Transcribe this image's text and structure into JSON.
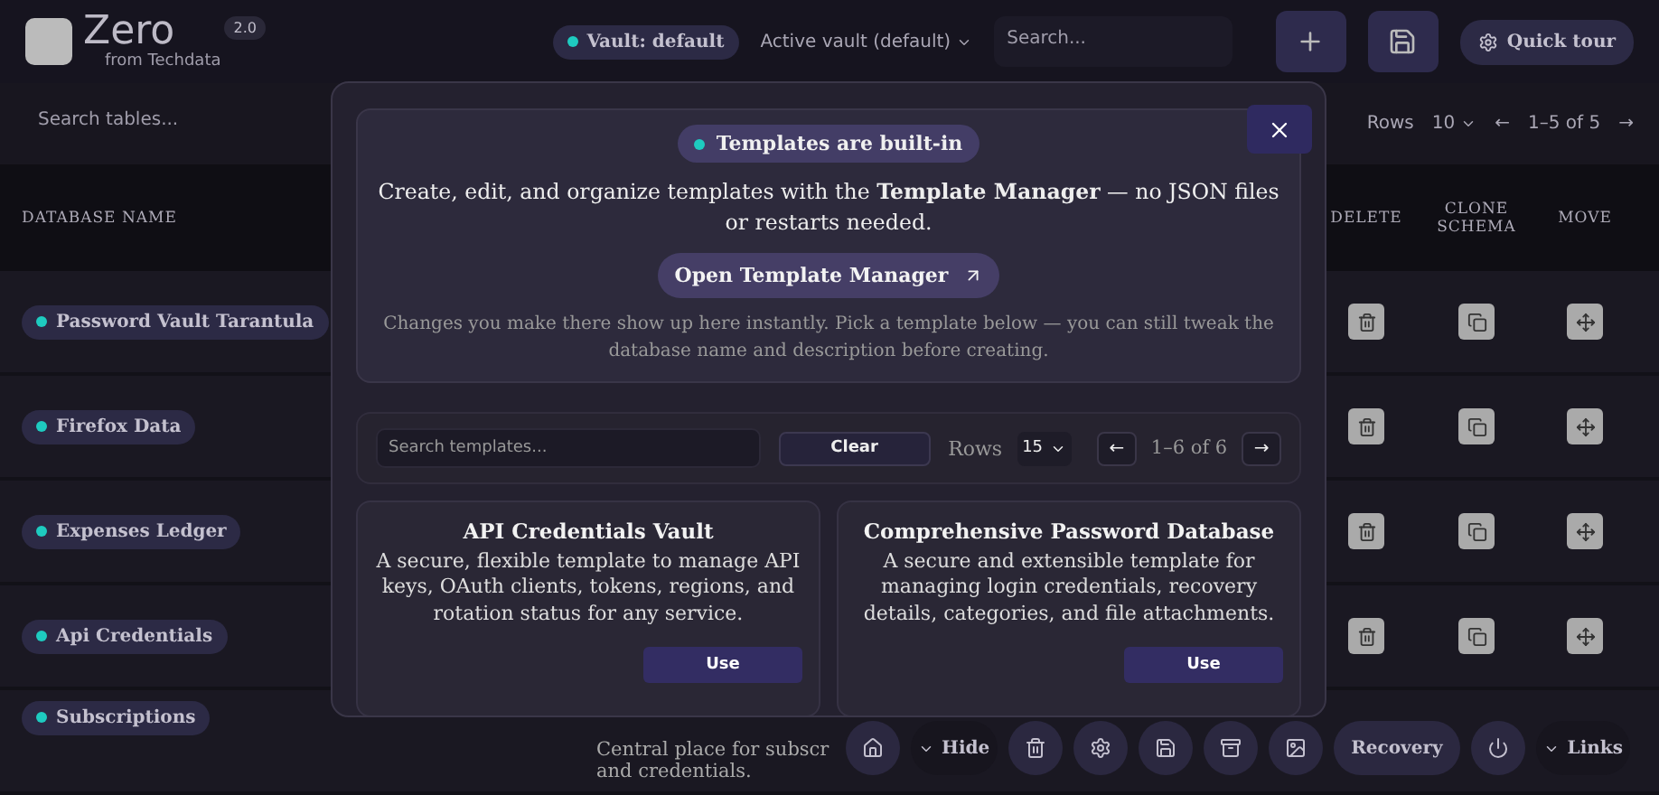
{
  "header": {
    "logo_text": "Zero",
    "version": "2.0",
    "subtitle": "from Techdata",
    "vault_badge": "Vault: default",
    "vault_select": "Active vault (default)",
    "search": {
      "placeholder": "Search..."
    },
    "quick_tour": "Quick tour"
  },
  "toolbar": {
    "search": {
      "placeholder": "Search tables..."
    },
    "rows_label": "Rows",
    "rows_value": "10",
    "range": "1–5 of 5",
    "prev": "←",
    "next": "→"
  },
  "table": {
    "columns": [
      "DATABASE NAME",
      "DELETE",
      "CLONE SCHEMA",
      "MOVE"
    ],
    "rows": [
      {
        "name": "Password Vault Tarantula",
        "actions_visible": true
      },
      {
        "name": "Firefox Data",
        "actions_visible": true
      },
      {
        "name": "Expenses Ledger",
        "actions_visible": true
      },
      {
        "name": "Api Credentials",
        "actions_visible": true
      },
      {
        "name": "Subscriptions",
        "description": "Central place for subscr\nand credentials.",
        "actions_visible": false
      }
    ]
  },
  "dock": [
    {
      "kind": "home"
    },
    {
      "kind": "toggle",
      "label": "Hide"
    },
    {
      "kind": "trash"
    },
    {
      "kind": "gear"
    },
    {
      "kind": "save"
    },
    {
      "kind": "archive"
    },
    {
      "kind": "image"
    },
    {
      "kind": "pill",
      "label": "Recovery"
    },
    {
      "kind": "power"
    },
    {
      "kind": "toggle",
      "label": "Links"
    }
  ],
  "modal": {
    "badge": "Templates are built-in",
    "intro": "Create, edit, and organize templates with the **Template Manager** — no JSON files or restarts needed.",
    "open_button": "Open Template Manager",
    "note": "Changes you make there show up here instantly. Pick a template below — you can still tweak the database name and description before creating.",
    "search": {
      "placeholder": "Search templates..."
    },
    "clear_button": "Clear",
    "rows_label": "Rows",
    "rows_value": "15",
    "range": "1–6 of 6",
    "prev": "←",
    "next": "→",
    "templates": [
      {
        "title": "API Credentials Vault",
        "description": "A secure, flexible template to manage API keys, OAuth clients, tokens, regions, and rotation status for any service.",
        "button": "Use"
      },
      {
        "title": "Comprehensive Password Database",
        "description": "A secure and extensible template for managing login credentials, recovery details, categories, and file attachments.",
        "button": "Use"
      }
    ]
  }
}
